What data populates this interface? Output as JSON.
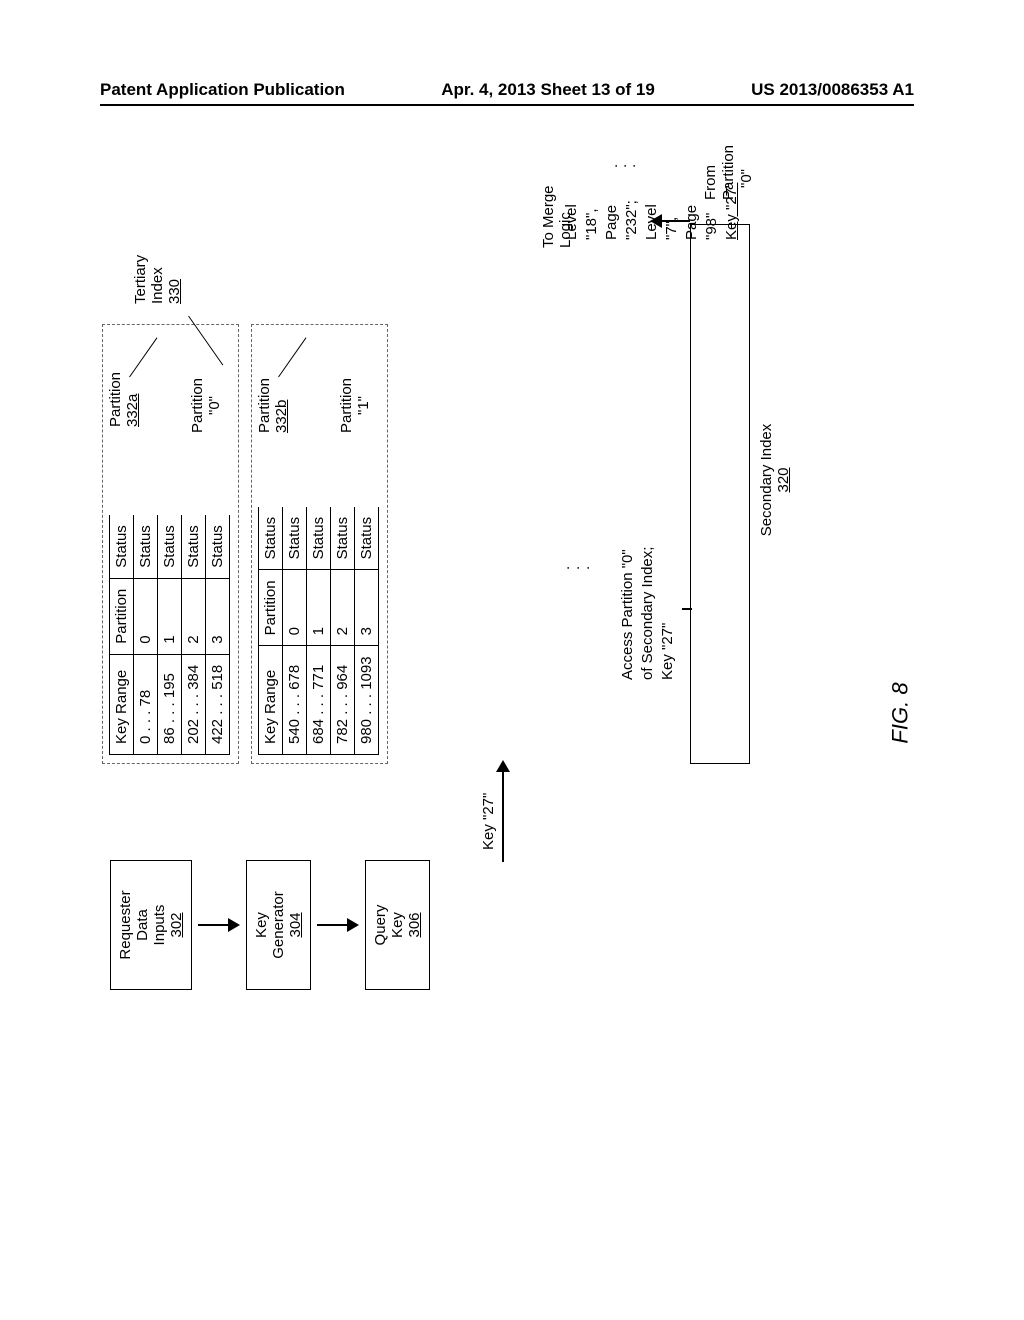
{
  "header": {
    "left": "Patent Application Publication",
    "center": "Apr. 4, 2013  Sheet 13 of 19",
    "right": "US 2013/0086353 A1"
  },
  "left_col": {
    "requester": {
      "l1": "Requester",
      "l2": "Data",
      "l3": "Inputs",
      "ref": "302"
    },
    "keygen": {
      "l1": "Key",
      "l2": "Generator",
      "ref": "304"
    },
    "query": {
      "l1": "Query",
      "l2": "Key",
      "ref": "306"
    }
  },
  "key_arrow_label": "Key \"27\"",
  "tertiary_label": {
    "l1": "Tertiary",
    "l2": "Index",
    "ref": "330"
  },
  "partA": {
    "tag": "Partition",
    "tagref": "332a",
    "name": "Partition",
    "name2": "\"0\"",
    "hdr": {
      "c1": "Key Range",
      "c2": "Partition",
      "c3": "Status"
    },
    "rows": [
      {
        "c1": "0 . . . 78",
        "c2": "0",
        "c3": "Status"
      },
      {
        "c1": "86 . . . 195",
        "c2": "1",
        "c3": "Status"
      },
      {
        "c1": "202 . . . 384",
        "c2": "2",
        "c3": "Status"
      },
      {
        "c1": "422 . . . 518",
        "c2": "3",
        "c3": "Status"
      }
    ]
  },
  "partB": {
    "tag": "Partition",
    "tagref": "332b",
    "name": "Partition",
    "name2": "\"1\"",
    "hdr": {
      "c1": "Key Range",
      "c2": "Partition",
      "c3": "Status"
    },
    "rows": [
      {
        "c1": "540 . . . 678",
        "c2": "0",
        "c3": "Status"
      },
      {
        "c1": "684 . . . 771",
        "c2": "1",
        "c3": "Status"
      },
      {
        "c1": "782 . . . 964",
        "c2": "2",
        "c3": "Status"
      },
      {
        "c1": "980 . . . 1093",
        "c2": "3",
        "c3": "Status"
      }
    ]
  },
  "access_note": {
    "l1": "Access Partition \"0\"",
    "l2": "of Secondary Index;",
    "l3": "Key \"27\""
  },
  "sec_index": {
    "label": "Secondary Index",
    "ref": "320"
  },
  "output": {
    "l1": "Level \"18\",",
    "l2": "Page \"232\";",
    "l3": "Level \"7\",",
    "l4": "Page \"98\"",
    "l5": "Key \"27\""
  },
  "merge": "To Merge Logic",
  "from": {
    "l1": "From",
    "l2": "Partition",
    "l3": "\"0\""
  },
  "figcap": "FIG. 8"
}
